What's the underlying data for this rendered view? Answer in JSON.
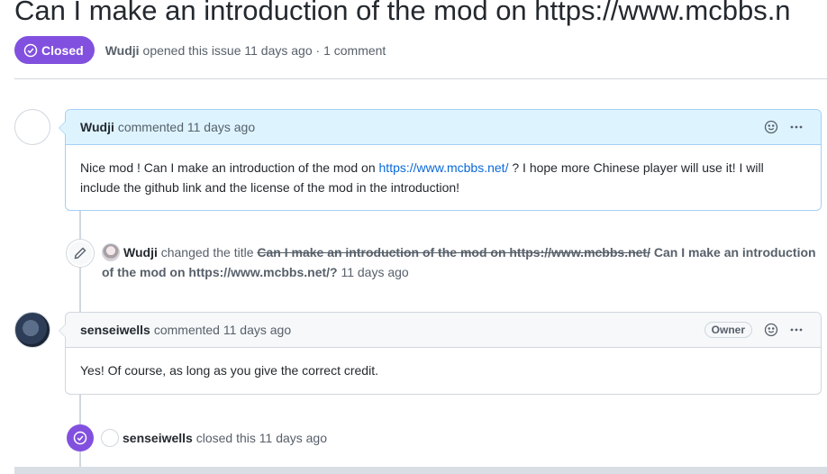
{
  "issue": {
    "title": "Can I make an introduction of the mod on https://www.mcbbs.n",
    "state_label": "Closed",
    "author": "Wudji",
    "meta_text": "opened this issue 11 days ago · 1 comment"
  },
  "comments": [
    {
      "author": "Wudji",
      "action": "commented 11 days ago",
      "body_before_link": "Nice mod ! Can I make an introduction of the mod on ",
      "link_text": "https://www.mcbbs.net/",
      "body_after_link": " ?  I hope more Chinese player will use it! I will include the github link and the license of the mod in the introduction!"
    },
    {
      "author": "senseiwells",
      "action": "commented 11 days ago",
      "badge": "Owner",
      "body": "Yes! Of course, as long as you give the correct credit."
    }
  ],
  "events": {
    "rename": {
      "actor": "Wudji",
      "action": "changed the title",
      "old_title": "Can I make an introduction of the mod on https://www.mcbbs.net/",
      "new_title": "Can I make an introduction of the mod on https://www.mcbbs.net/?",
      "time": "11 days ago"
    },
    "closed": {
      "actor": "senseiwells",
      "action": "closed this",
      "time": "11 days ago"
    }
  },
  "icons": {
    "state": "issue-closed-icon",
    "reaction": "smiley-icon",
    "more": "kebab-horizontal-icon",
    "rename": "pencil-icon"
  },
  "colors": {
    "closed_purple": "#8250df",
    "link_blue": "#0969da",
    "author_header_bg": "#ddf4ff",
    "header_bg": "#f6f8fa",
    "border": "#d0d7de"
  }
}
